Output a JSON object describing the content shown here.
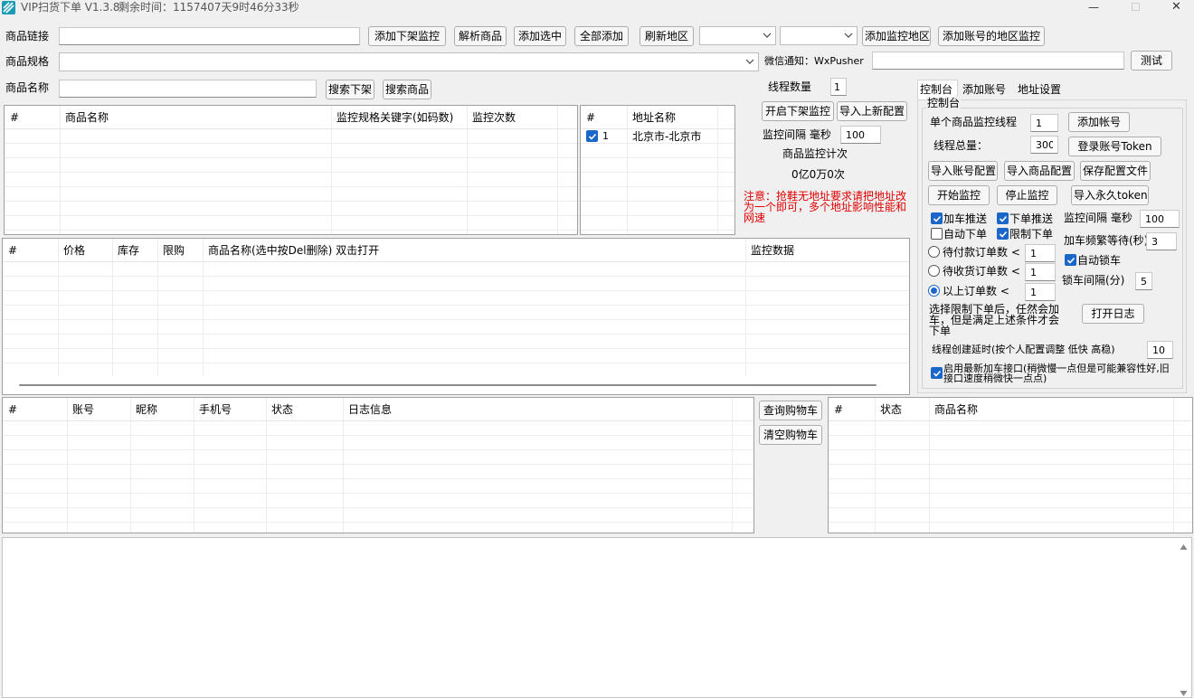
{
  "window": {
    "title": "VIP扫货下单 V1.3.8",
    "remaining": "剩余时间：1157407天9时46分33秒",
    "minimize_glyph": "—",
    "maximize_glyph": "☐",
    "close_glyph": "✕"
  },
  "top": {
    "link_label": "商品链接",
    "link_value": "",
    "btn_add_offline": "添加下架监控",
    "btn_parse": "解析商品",
    "btn_add_selected": "添加选中",
    "btn_add_all": "全部添加",
    "btn_refresh_region": "刷新地区",
    "btn_add_region_monitor": "添加监控地区",
    "btn_add_account_region": "添加账号的地区监控",
    "spec_label": "商品规格",
    "wechat_label": "微信通知：WxPusher",
    "wechat_value": "",
    "btn_test": "测试",
    "name_label": "商品名称",
    "name_value": "",
    "btn_search_offline": "搜索下架",
    "btn_search_product": "搜索商品"
  },
  "monitor_table": {
    "headers": [
      "#",
      "商品名称",
      "监控规格关键字(如码数)",
      "监控次数"
    ]
  },
  "address_table": {
    "headers": [
      "#",
      "地址名称"
    ],
    "rows": [
      {
        "num": "1",
        "name": "北京市-北京市",
        "checked": true
      }
    ]
  },
  "middle": {
    "thread_count_label": "线程数量",
    "thread_count_value": "1",
    "btn_start_offline": "开启下架监控",
    "btn_import_config": "导入上新配置",
    "interval_label": "监控间隔 毫秒",
    "interval_value": "100",
    "counter_label": "商品监控计次",
    "counter_value": "0亿0万0次",
    "notice": "注意：抢鞋无地址要求请把地址改为一个即可，多个地址影响性能和网速"
  },
  "product_table": {
    "headers": [
      "#",
      "价格",
      "库存",
      "限购",
      "商品名称(选中按Del删除) 双击打开",
      "监控数据"
    ]
  },
  "account_table": {
    "headers": [
      "#",
      "账号",
      "昵称",
      "手机号",
      "状态",
      "日志信息"
    ]
  },
  "cart": {
    "btn_query": "查询购物车",
    "btn_clear": "清空购物车"
  },
  "cart_table": {
    "headers": [
      "#",
      "状态",
      "商品名称"
    ]
  },
  "tabs": [
    {
      "label": "控制台",
      "active": true
    },
    {
      "label": "添加账号",
      "active": false
    },
    {
      "label": "地址设置",
      "active": false
    }
  ],
  "console": {
    "group_title": "控制台",
    "single_thread_label": "单个商品监控线程",
    "single_thread_value": "1",
    "btn_add_account": "添加帐号",
    "total_thread_label": "线程总量：",
    "total_thread_value": "300",
    "btn_login_token": "登录账号Token",
    "btn_import_account": "导入账号配置",
    "btn_import_product": "导入商品配置",
    "btn_save_config": "保存配置文件",
    "btn_start": "开始监控",
    "btn_stop": "停止监控",
    "btn_import_token": "导入永久token",
    "cb_cart_push": {
      "label": "加车推送",
      "checked": true
    },
    "cb_order_push": {
      "label": "下单推送",
      "checked": true
    },
    "cb_auto_order": {
      "label": "自动下单",
      "checked": false
    },
    "cb_limit_order": {
      "label": "限制下单",
      "checked": true
    },
    "monitor_interval_label": "监控间隔 毫秒",
    "monitor_interval_value": "100",
    "cart_wait_label": "加车频繁等待(秒)",
    "cart_wait_value": "3",
    "cb_auto_lock": {
      "label": "自动锁车",
      "checked": true
    },
    "lock_interval_label": "锁车间隔(分)",
    "lock_interval_value": "5",
    "radio_unpaid": {
      "label": "待付款订单数 <",
      "value": "1",
      "selected": false
    },
    "radio_unreceived": {
      "label": "待收货订单数 <",
      "value": "1",
      "selected": false
    },
    "radio_above": {
      "label": "以上订单数 <",
      "value": "1",
      "selected": true
    },
    "limit_note": "选择限制下单后，任然会加车，但是满足上述条件才会下单",
    "btn_open_log": "打开日志",
    "delay_label": "线程创建延时(按个人配置调整 低快 高稳)",
    "delay_value": "10",
    "cb_new_api": {
      "label": "启用最新加车接口(稍微慢一点但是可能兼容性好,旧接口速度稍微快一点点)",
      "checked": true
    }
  },
  "colors": {
    "accent": "#1a67c9",
    "warning": "#e00000",
    "window_bg": "#f0f0f0"
  }
}
